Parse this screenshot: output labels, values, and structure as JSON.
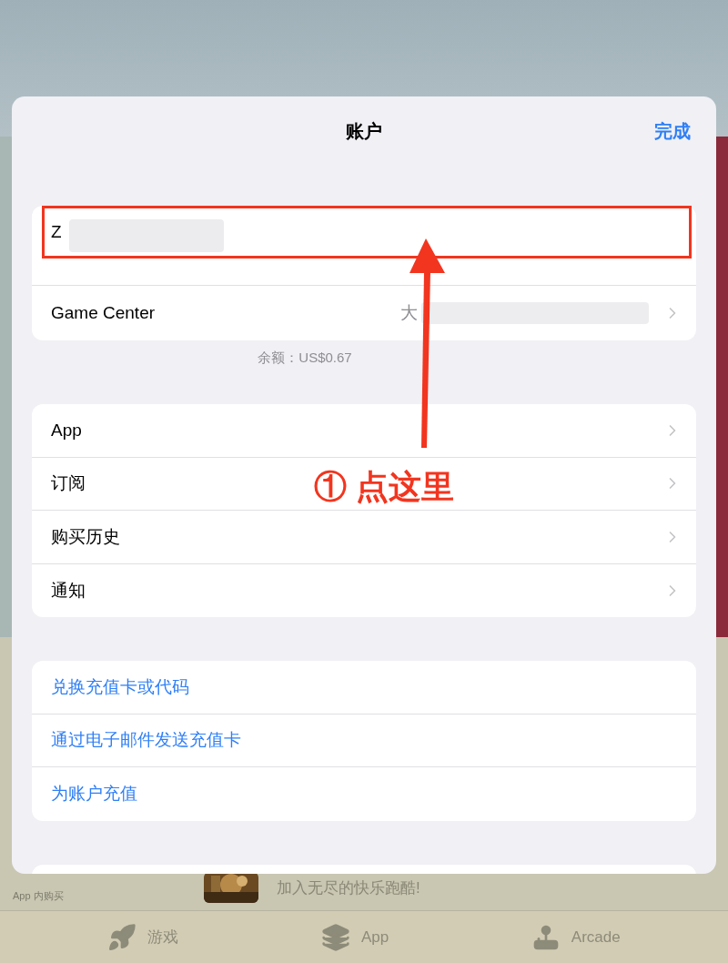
{
  "window": {
    "title": "账户",
    "done_button": "完成"
  },
  "account": {
    "name": "Z"
  },
  "game_center": {
    "label": "Game Center",
    "value": "大"
  },
  "balance": "余额：US$0.67",
  "menu_items": [
    {
      "label": "App"
    },
    {
      "label": "订阅"
    },
    {
      "label": "购买历史"
    },
    {
      "label": "通知"
    }
  ],
  "actions": [
    {
      "label": "兑换充值卡或代码"
    },
    {
      "label": "通过电子邮件发送充值卡"
    },
    {
      "label": "为账户充值"
    }
  ],
  "annotation": {
    "text": "① 点这里"
  },
  "background": {
    "iap_label": "App 内购买",
    "promo_text": "加入无尽的快乐跑酷!"
  },
  "tab_bar": [
    {
      "label": "游戏",
      "kind": "rocket"
    },
    {
      "label": "App",
      "kind": "stack"
    },
    {
      "label": "Arcade",
      "kind": "joystick"
    }
  ]
}
